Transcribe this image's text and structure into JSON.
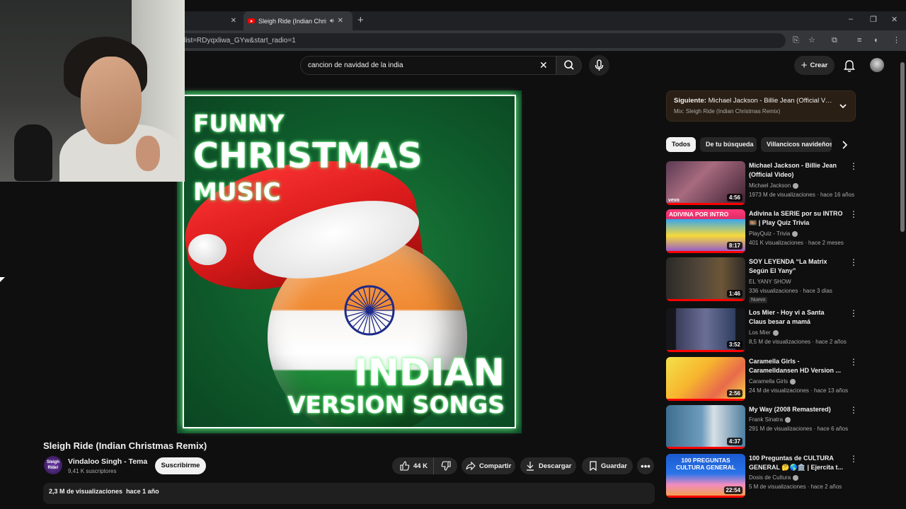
{
  "browser": {
    "active_tab_title": "Sleigh Ride (Indian Christm",
    "url": "list=RDyqxliwa_GYw&start_radio=1",
    "icons": [
      "close-icon",
      "audio-icon",
      "new-tab-icon",
      "minimize-icon",
      "maximize-icon",
      "install-icon",
      "star-icon",
      "extensions-icon",
      "media-icon",
      "profile-icon",
      "menu-icon"
    ]
  },
  "header": {
    "search_value": "cancion de navidad de la india",
    "create_label": "Crear"
  },
  "album": {
    "line1": "FUNNY",
    "line2": "CHRISTMAS",
    "line3": "MUSIC",
    "line4": "INDIAN",
    "line5": "VERSION SONGS"
  },
  "video": {
    "title": "Sleigh Ride (Indian Christmas Remix)",
    "channel": "Vindaloo Singh - Tema",
    "subscribers": "9,41 K suscriptores",
    "subscribe_label": "Suscribirme",
    "channel_avatar_text": "Sleigh Ride!",
    "likes": "44 K",
    "share_label": "Compartir",
    "download_label": "Descargar",
    "save_label": "Guardar",
    "views": "2,3 M de visualizaciones",
    "age": "hace 1 año"
  },
  "next": {
    "label": "Siguiente:",
    "title": "Michael Jackson - Billie Jean (Official Vi...",
    "subtitle": "Mix: Sleigh Ride (Indian Christmas Remix)"
  },
  "chips": [
    "Todos",
    "De tu búsqueda",
    "Villancicos navideños"
  ],
  "recommendations": [
    {
      "title": "Michael Jackson - Billie Jean (Official Video)",
      "channel": "Michael Jackson",
      "views": "1973 M de visualizaciones",
      "age": "hace 16 años",
      "duration": "4:56",
      "verified": true,
      "badge": ""
    },
    {
      "title": "Adivina la SERIE por su INTRO 🎞️ | Play Quiz Trivia",
      "channel": "PlayQuiz - Trivia",
      "views": "401 K visualizaciones",
      "age": "hace 2 meses",
      "duration": "8:17",
      "verified": true,
      "badge": ""
    },
    {
      "title": "SOY LEYENDA “La Matrix Según El Yany”",
      "channel": "EL YANY SHOW",
      "views": "336 visualizaciones",
      "age": "hace 3 días",
      "duration": "1:46",
      "verified": false,
      "badge": "Nuevo"
    },
    {
      "title": "Los Mier - Hoy vi a Santa Claus besar a mamá",
      "channel": "Los Mier",
      "views": "8,5 M de visualizaciones",
      "age": "hace 2 años",
      "duration": "3:52",
      "verified": true,
      "badge": ""
    },
    {
      "title": "Caramella Girls - Caramelldansen HD Version ...",
      "channel": "Caramella Girls",
      "views": "24 M de visualizaciones",
      "age": "hace 13 años",
      "duration": "2:56",
      "verified": true,
      "badge": ""
    },
    {
      "title": "My Way (2008 Remastered)",
      "channel": "Frank Sinatra",
      "views": "291 M de visualizaciones",
      "age": "hace 6 años",
      "duration": "4:37",
      "verified": true,
      "badge": ""
    },
    {
      "title": "100 Preguntas de CULTURA GENERAL 🤔🌎🏛️ | Ejercita t...",
      "channel": "Dosis de Cultura",
      "views": "5 M de visualizaciones",
      "age": "hace 2 años",
      "duration": "22:54",
      "verified": true,
      "badge": ""
    }
  ],
  "thumb_overlays": {
    "adivina": "ADIVINA POR INTRO",
    "preguntas": "100 PREGUNTAS CULTURA GENERAL",
    "vevo": "vevo"
  },
  "colors": {
    "background": "#0f0f0f",
    "accent_red": "#ff0000",
    "album_green": "#0f5d2c",
    "next_box": "#2a1f14"
  }
}
